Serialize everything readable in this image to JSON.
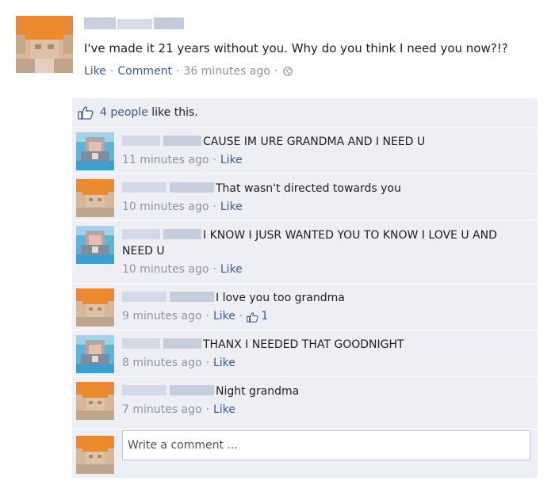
{
  "post": {
    "text": "I've made it 21 years without you. Why do you think I need you now?!?",
    "like_label": "Like",
    "comment_label": "Comment",
    "timestamp": "36 minutes ago",
    "audience_icon": "globe-icon"
  },
  "likes": {
    "text_link": "4 people",
    "text_rest": " like this.",
    "icon": "thumbs-up-icon"
  },
  "comments": [
    {
      "text": "CAUSE IM URE GRANDMA AND I NEED U",
      "time": "11 minutes ago",
      "like_label": "Like",
      "author": "grandma"
    },
    {
      "text": "That wasn't directed towards you",
      "time": "10 minutes ago",
      "like_label": "Like",
      "author": "poster"
    },
    {
      "text": "I KNOW I JUSR WANTED YOU TO KNOW I LOVE U AND NEED U",
      "time": "10 minutes ago",
      "like_label": "Like",
      "author": "grandma"
    },
    {
      "text": "I love you too grandma",
      "time": "9 minutes ago",
      "like_label": "Like",
      "like_count": "1",
      "author": "poster"
    },
    {
      "text": "THANX I NEEDED THAT GOODNIGHT",
      "time": "8 minutes ago",
      "like_label": "Like",
      "author": "grandma"
    },
    {
      "text": "Night grandma",
      "time": "7 minutes ago",
      "like_label": "Like",
      "author": "poster"
    }
  ],
  "composer": {
    "placeholder": "Write a comment ..."
  },
  "colors": {
    "link": "#3b5998",
    "meta": "#90949c",
    "panel": "#edeff4"
  }
}
